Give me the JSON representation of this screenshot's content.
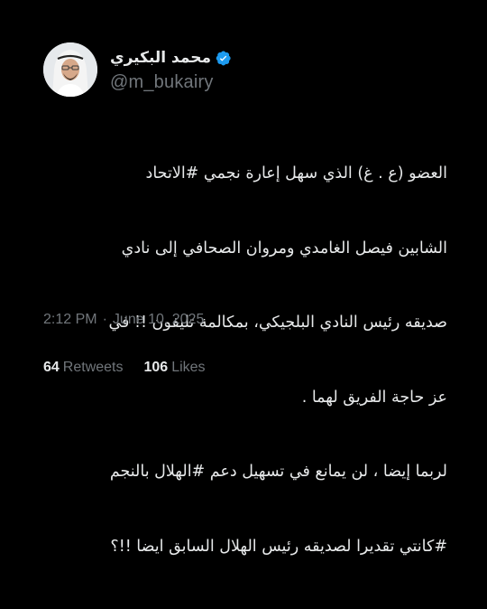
{
  "author": {
    "display_name": "محمد البكيري",
    "handle": "@m_bukairy",
    "verified": true,
    "verified_badge_color": "#1d9bf0"
  },
  "tweet": {
    "lines": [
      "العضو  (ع . غ) الذي سهل إعارة نجمي #الاتحاد",
      "الشابين فيصل الغامدي ومروان الصحافي إلى نادي",
      "صديقه رئيس النادي  البلجيكي، بمكالمة تليفون !! في",
      "عز حاجة الفريق لهما .",
      "لربما إيضا ، لن يمانع في تسهيل دعم #الهلال بالنجم",
      "#كانتي تقديرا لصديقه رئيس الهلال السابق  ايضا !!؟"
    ],
    "time": "2:12 PM",
    "separator": "·",
    "date": "June 10, 2025"
  },
  "stats": {
    "retweets_count": "64",
    "retweets_label": "Retweets",
    "likes_count": "106",
    "likes_label": "Likes"
  },
  "colors": {
    "background": "#000000",
    "primary_text": "#e7e9ea",
    "secondary_text": "#71767b"
  }
}
